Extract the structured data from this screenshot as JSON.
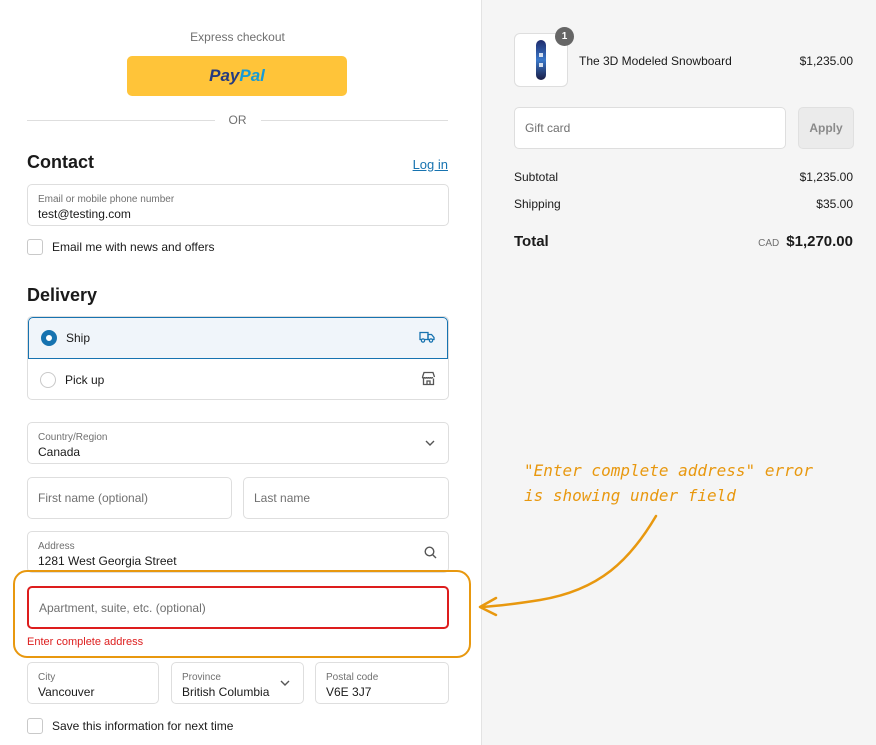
{
  "express": {
    "label": "Express checkout",
    "paypal_part1": "Pay",
    "paypal_part2": "Pal",
    "or_label": "OR"
  },
  "contact": {
    "title": "Contact",
    "login_label": "Log in",
    "email_label": "Email or mobile phone number",
    "email_value": "test@testing.com",
    "newsletter_label": "Email me with news and offers"
  },
  "delivery": {
    "title": "Delivery",
    "options": [
      {
        "label": "Ship",
        "selected": true,
        "icon": "truck-icon"
      },
      {
        "label": "Pick up",
        "selected": false,
        "icon": "store-icon"
      }
    ],
    "country_label": "Country/Region",
    "country_value": "Canada",
    "first_name_placeholder": "First name (optional)",
    "last_name_placeholder": "Last name",
    "address_label": "Address",
    "address_value": "1281 West Georgia Street",
    "apartment_placeholder": "Apartment, suite, etc. (optional)",
    "apartment_error": "Enter complete address",
    "city_label": "City",
    "city_value": "Vancouver",
    "province_label": "Province",
    "province_value": "British Columbia",
    "postal_label": "Postal code",
    "postal_value": "V6E 3J7",
    "save_info_label": "Save this information for next time"
  },
  "annotation": {
    "line1": "\"Enter complete address\" error",
    "line2": "is showing under field"
  },
  "order": {
    "quantity": "1",
    "product_name": "The 3D Modeled Snowboard",
    "product_price": "$1,235.00",
    "gift_placeholder": "Gift card",
    "apply_label": "Apply",
    "subtotal_label": "Subtotal",
    "subtotal_value": "$1,235.00",
    "shipping_label": "Shipping",
    "shipping_value": "$35.00",
    "total_label": "Total",
    "total_currency": "CAD",
    "total_value": "$1,270.00"
  },
  "colors": {
    "accent": "#1773b0",
    "error": "#dd1d1d",
    "paypal_yellow": "#ffc439",
    "annotation": "#e8980f"
  }
}
